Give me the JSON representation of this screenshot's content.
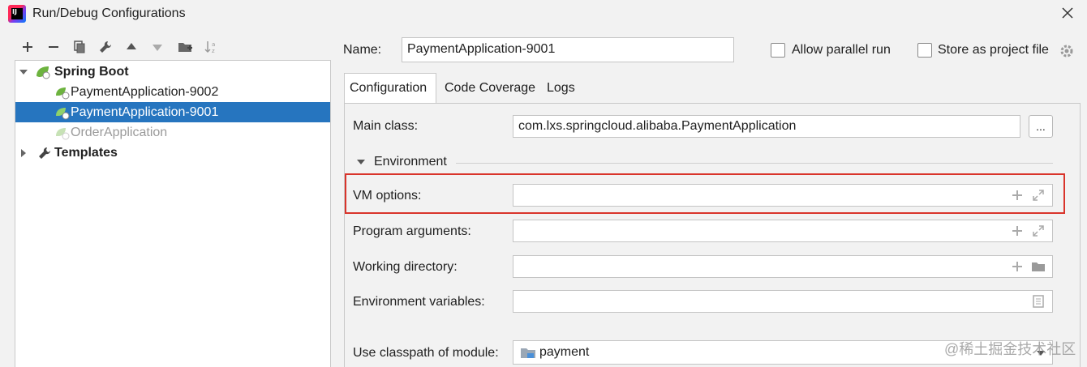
{
  "window": {
    "title": "Run/Debug Configurations"
  },
  "toolbar": {
    "icons": [
      "add-icon",
      "remove-icon",
      "copy-icon",
      "wrench-icon",
      "move-up-icon",
      "move-down-icon",
      "folder-add-icon",
      "sort-icon"
    ]
  },
  "tree": {
    "groups": [
      {
        "label": "Spring Boot",
        "expanded": true,
        "items": [
          {
            "label": "PaymentApplication-9002",
            "state": "normal"
          },
          {
            "label": "PaymentApplication-9001",
            "state": "selected"
          },
          {
            "label": "OrderApplication",
            "state": "disabled"
          }
        ]
      },
      {
        "label": "Templates",
        "expanded": false
      }
    ]
  },
  "header": {
    "name_label": "Name:",
    "name_value": "PaymentApplication-9001",
    "parallel_label": "Allow parallel run",
    "store_label": "Store as project file"
  },
  "tabs": [
    {
      "label": "Configuration",
      "active": true
    },
    {
      "label": "Code Coverage",
      "active": false
    },
    {
      "label": "Logs",
      "active": false
    }
  ],
  "form": {
    "main_class_label": "Main class:",
    "main_class_value": "com.lxs.springcloud.alibaba.PaymentApplication",
    "browse_label": "...",
    "environment_label": "Environment",
    "vm_options_label": "VM options:",
    "vm_options_value": "",
    "program_args_label": "Program arguments:",
    "program_args_value": "",
    "working_dir_label": "Working directory:",
    "working_dir_value": "",
    "env_vars_label": "Environment variables:",
    "env_vars_value": "",
    "classpath_label": "Use classpath of module:",
    "classpath_value": "payment"
  },
  "watermark": "@稀土掘金技术社区",
  "colors": {
    "selection": "#2675bf",
    "highlight": "#d9342b",
    "spring": "#6db33f"
  }
}
